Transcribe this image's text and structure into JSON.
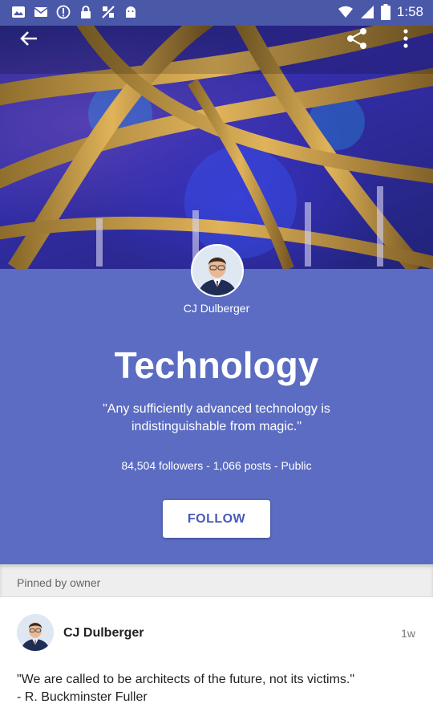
{
  "status_bar": {
    "time": "1:58",
    "icons": [
      "photo-icon",
      "email-icon",
      "info-icon",
      "lock-icon",
      "no-signal-icon",
      "android-icon",
      "wifi-icon",
      "signal-icon",
      "battery-icon"
    ]
  },
  "header": {
    "icons": [
      "back-arrow-icon",
      "share-icon",
      "more-vert-icon"
    ]
  },
  "community": {
    "owner_name": "CJ Dulberger",
    "title": "Technology",
    "tagline": "\"Any sufficiently advanced technology is indistinguishable from magic.\"",
    "stats": "84,504 followers - 1,066 posts - Public",
    "follow_label": "FOLLOW"
  },
  "pinned": {
    "label": "Pinned by owner"
  },
  "post": {
    "author": "CJ Dulberger",
    "time": "1w",
    "text": "\"We are called to be architects of the future, not its victims.\"\n- R. Buckminster Fuller"
  },
  "colors": {
    "status_bar": "#4a58a8",
    "panel": "#5b6cc2",
    "follow_text": "#4a59b5",
    "pinned_bg": "#eeeeee"
  }
}
